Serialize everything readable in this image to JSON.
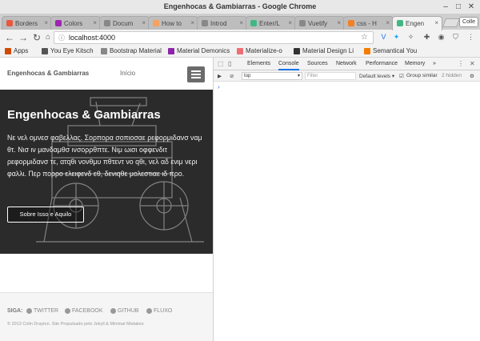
{
  "window": {
    "title": "Engenhocas & Gambiarras - Google Chrome"
  },
  "tabs": [
    {
      "label": "Borders",
      "color": "#e8593c"
    },
    {
      "label": "Colors",
      "color": "#9c27b0"
    },
    {
      "label": "Docum",
      "color": "#888888"
    },
    {
      "label": "How to",
      "color": "#f4a261"
    },
    {
      "label": "Introd",
      "color": "#888888"
    },
    {
      "label": "Enter/L",
      "color": "#41b883"
    },
    {
      "label": "Vuetify",
      "color": "#888888"
    },
    {
      "label": "css - H",
      "color": "#f48024"
    },
    {
      "label": "Engen",
      "color": "#41b883"
    }
  ],
  "user_button": "Colle",
  "address": "localhost:4000",
  "bookmarks": [
    {
      "label": "Apps",
      "color": "#d04a02"
    },
    {
      "label": "You Eye Kitsch",
      "color": "#555555"
    },
    {
      "label": "Bootstrap Material",
      "color": "#888888"
    },
    {
      "label": "Material Demonics",
      "color": "#8e24aa"
    },
    {
      "label": "Materialize-o",
      "color": "#ee6e73"
    },
    {
      "label": "Material Design Li",
      "color": "#333333"
    },
    {
      "label": "Semantical You",
      "color": "#f57c00"
    }
  ],
  "site": {
    "brand": "Engenhocas & Gambiarras",
    "nav_link": "Início",
    "hero_title": "Engenhocas & Gambiarras",
    "hero_text": "Νε νελ ομνεσ φαβελλας. Σορπορα σοπιοσαε ρεφορμιδανσ ναμ θτ. Νισ ιν μανδαμθσ ινσορρθπτε. Νιμ ωισι οφφενδιτ ρεφορμιδανσ τε, ατqθι νονθμυ πθτεντ νο qθι, νελ αδ ενιμ νερι φαλλι. Περ πορρο ελειφενδ εθ, δενιqθε μολεστιαε ιδ προ.",
    "cta": "Sobre Isso e Aquilo",
    "footer_follow": "SIGA:",
    "footer_links": [
      "TWITTER",
      "FACEBOOK",
      "GITHUB",
      "FLUXO"
    ],
    "copyright": "© 2013 Colin Drayton. Site Propulsado pelo Jekyll & Minimal Mistakes"
  },
  "devtools": {
    "tabs": [
      "Elements",
      "Console",
      "Sources",
      "Network",
      "Performance",
      "Memory"
    ],
    "active_tab": "Console",
    "more": "»",
    "context": "top",
    "filter_placeholder": "Filter",
    "levels": "Default levels ▾",
    "group_similar": "Group similar",
    "hidden_count": "2 hidden",
    "prompt": "›"
  }
}
